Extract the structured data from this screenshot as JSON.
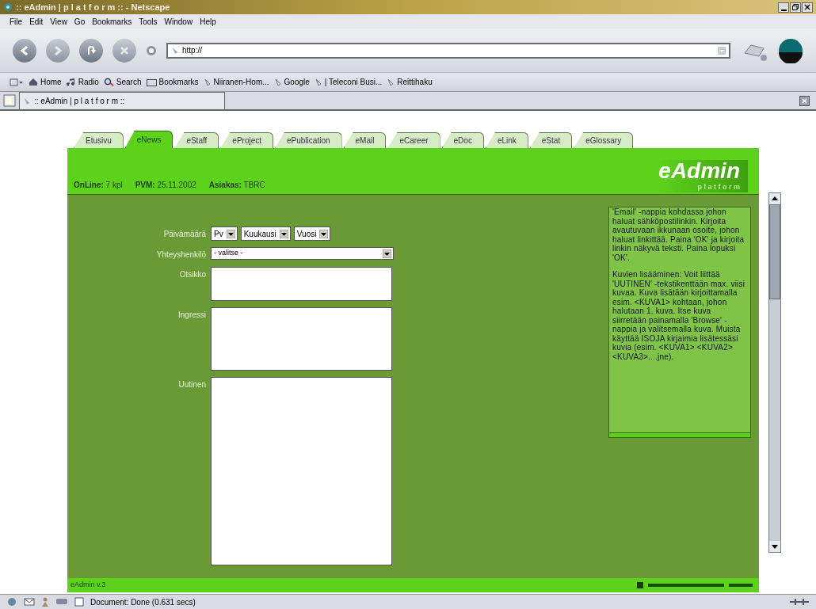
{
  "window": {
    "title": ":: eAdmin | p l a t f o r m :: - Netscape"
  },
  "menu": [
    "File",
    "Edit",
    "View",
    "Go",
    "Bookmarks",
    "Tools",
    "Window",
    "Help"
  ],
  "address_bar": {
    "value": "http://"
  },
  "bookmarks": [
    {
      "label": "Home",
      "kind": "home"
    },
    {
      "label": "Radio",
      "kind": "radio"
    },
    {
      "label": "Search",
      "kind": "search"
    },
    {
      "label": "Bookmarks",
      "kind": "folder"
    },
    {
      "label": "Niiranen-Hom...",
      "kind": "link"
    },
    {
      "label": "Google",
      "kind": "link"
    },
    {
      "label": "| Teleconi Busi...",
      "kind": "link"
    },
    {
      "label": "Reittihaku",
      "kind": "link"
    }
  ],
  "browser_tab": {
    "title": ":: eAdmin | p l a t f o r m ::"
  },
  "page": {
    "tabs": [
      {
        "label": "Etusivu",
        "selected": false
      },
      {
        "label": "eNews",
        "selected": true
      },
      {
        "label": "eStaff",
        "selected": false
      },
      {
        "label": "eProject",
        "selected": false
      },
      {
        "label": "ePublication",
        "selected": false
      },
      {
        "label": "eMail",
        "selected": false
      },
      {
        "label": "eCareer",
        "selected": false
      },
      {
        "label": "eDoc",
        "selected": false
      },
      {
        "label": "eLink",
        "selected": false
      },
      {
        "label": "eStat",
        "selected": false
      },
      {
        "label": "eGlossary",
        "selected": false
      }
    ],
    "info": [
      {
        "label": "OnLine:",
        "value": "7 kpl"
      },
      {
        "label": "PVM:",
        "value": "25.11.2002"
      },
      {
        "label": "Asiakas:",
        "value": "TBRC"
      }
    ],
    "logo": {
      "title": "eAdmin",
      "subtitle": "p l a t f o r m"
    },
    "form": [
      {
        "label": "Päivämäärä",
        "kind": "date",
        "selects": [
          "Pv",
          "Kuukausi",
          "Vuosi"
        ]
      },
      {
        "label": "Yhteyshenkilö",
        "kind": "select",
        "value": "- valitse -"
      },
      {
        "label": "Otsikko",
        "kind": "textbox"
      },
      {
        "label": "Ingressi",
        "kind": "textarea"
      },
      {
        "label": "Uutinen",
        "kind": "editor"
      }
    ],
    "help": [
      "'Email' -nappia kohdassa johon haluat sähköpostilinkin. Kirjoita avautuvaan ikkunaan osoite, johon haluat linkittää. Paina 'OK' ja kirjoita linkin näkyvä teksti. Paina lopuksi 'OK'.",
      "Kuvien lisääminen: Voit liittää 'UUTINEN' -tekstikenttään max. viisi kuvaa. Kuva lisätään kirjoittamalla esim. <KUVA1> kohtaan, johon halutaan 1. kuva. Itse kuva siirretään painamalla 'Browse' -nappia ja valitsemalla kuva. Muista käyttää ISOJA kirjaimia lisätessäsi kuvia (esim. <KUVA1> <KUVA2> <KUVA3>....jne)."
    ],
    "footer": {
      "version": "eAdmin v.3"
    }
  },
  "status_bar": {
    "text": "Document: Done (0.631 secs)"
  }
}
